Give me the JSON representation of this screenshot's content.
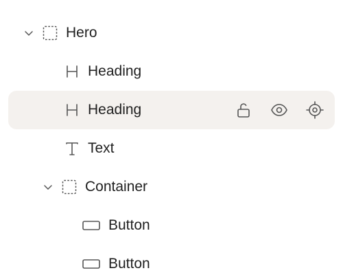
{
  "layers": [
    {
      "label": "Hero",
      "icon": "frame-dashed-icon",
      "expanded": true
    },
    {
      "label": "Heading",
      "icon": "heading-icon"
    },
    {
      "label": "Heading",
      "icon": "heading-icon",
      "selected": true
    },
    {
      "label": "Text",
      "icon": "text-icon"
    },
    {
      "label": "Container",
      "icon": "frame-dashed-icon",
      "expanded": true
    },
    {
      "label": "Button",
      "icon": "button-icon"
    },
    {
      "label": "Button",
      "icon": "button-icon"
    }
  ],
  "row_actions": [
    "unlock-icon",
    "eye-icon",
    "crosshair-icon"
  ],
  "colors": {
    "selected_bg": "#f4f1ee",
    "icon": "#555555",
    "text": "#1f1f1f"
  }
}
